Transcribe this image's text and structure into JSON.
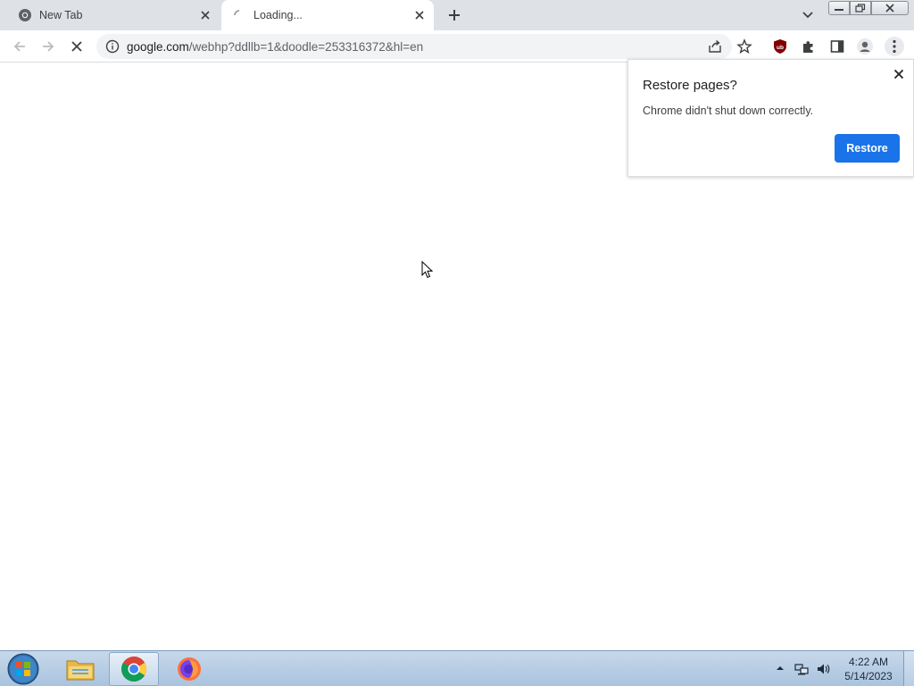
{
  "browser": {
    "tabs": [
      {
        "title": "New Tab",
        "favicon": "chrome-icon"
      },
      {
        "title": "Loading...",
        "favicon": "loading-spinner-icon",
        "active": true
      }
    ],
    "toolbar": {
      "url_domain": "google.com",
      "url_path": "/webhp?ddllb=1&doodle=253316372&hl=en",
      "icons": [
        "back-icon",
        "forward-icon",
        "stop-loading-icon",
        "site-info-icon",
        "share-icon",
        "bookmark-star-icon",
        "ublock-icon",
        "extensions-icon",
        "side-panel-icon",
        "profile-icon",
        "menu-icon"
      ]
    },
    "restore_bubble": {
      "title": "Restore pages?",
      "message": "Chrome didn't shut down correctly.",
      "button_label": "Restore"
    }
  },
  "taskbar": {
    "apps": [
      "start-button",
      "file-explorer",
      "google-chrome",
      "firefox"
    ],
    "clock": {
      "time": "4:22 AM",
      "date": "5/14/2023"
    }
  },
  "colors": {
    "tabstrip": "#dee1e6",
    "accent": "#1a73e8",
    "taskbar": "#b8cfe6"
  }
}
